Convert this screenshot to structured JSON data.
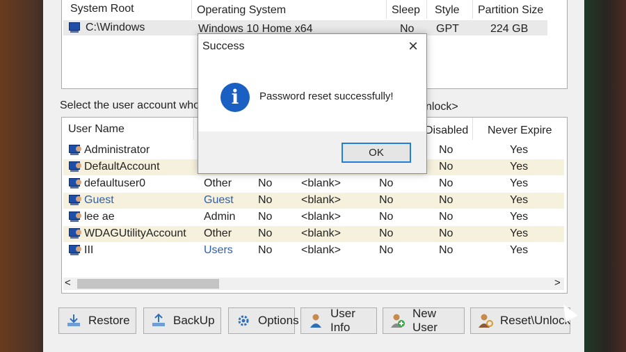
{
  "system_table": {
    "headers": [
      "System Root",
      "Operating System",
      "Sleep",
      "Style",
      "Partition Size"
    ],
    "row": {
      "root": "C:\\Windows",
      "os": "Windows 10 Home x64",
      "sleep": "No",
      "style": "GPT",
      "size": "224 GB"
    }
  },
  "instruction": {
    "left": "Select the user account whos",
    "right": "nlock>"
  },
  "user_table": {
    "headers": {
      "name": "User Name",
      "disabled": "Disabled",
      "never_expire": "Never Expire"
    },
    "rows": [
      {
        "name": "Administrator",
        "type": "",
        "c3": "",
        "c4": "",
        "c5": "",
        "disabled": "No",
        "never_expire": "Yes"
      },
      {
        "name": "DefaultAccount",
        "type": "",
        "c3": "",
        "c4": "",
        "c5": "",
        "disabled": "No",
        "never_expire": "Yes"
      },
      {
        "name": "defaultuser0",
        "type": "Other",
        "c3": "No",
        "c4": "<blank>",
        "c5": "No",
        "disabled": "No",
        "never_expire": "Yes"
      },
      {
        "name": "Guest",
        "type": "Guest",
        "c3": "No",
        "c4": "<blank>",
        "c5": "No",
        "disabled": "No",
        "never_expire": "Yes"
      },
      {
        "name": "lee ae",
        "type": "Admin",
        "c3": "No",
        "c4": "<blank>",
        "c5": "No",
        "disabled": "No",
        "never_expire": "Yes"
      },
      {
        "name": "WDAGUtilityAccount",
        "type": "Other",
        "c3": "No",
        "c4": "<blank>",
        "c5": "No",
        "disabled": "No",
        "never_expire": "Yes"
      },
      {
        "name": "III",
        "type": "Users",
        "c3": "No",
        "c4": "<blank>",
        "c5": "No",
        "disabled": "No",
        "never_expire": "Yes"
      }
    ]
  },
  "scroll": {
    "left": "<",
    "right": ">"
  },
  "buttons": {
    "restore": "Restore",
    "backup": "BackUp",
    "options": "Options",
    "user_info": "User Info",
    "new_user": "New User",
    "reset_unlock": "Reset\\Unlock"
  },
  "dialog": {
    "title": "Success",
    "close": "×",
    "message": "Password reset successfully!",
    "ok": "OK"
  },
  "colors": {
    "accent": "#1f7fd6",
    "info_icon": "#1a5fc2",
    "row_alt": "#f6f1dd",
    "blue_text": "#2d5fb0"
  }
}
